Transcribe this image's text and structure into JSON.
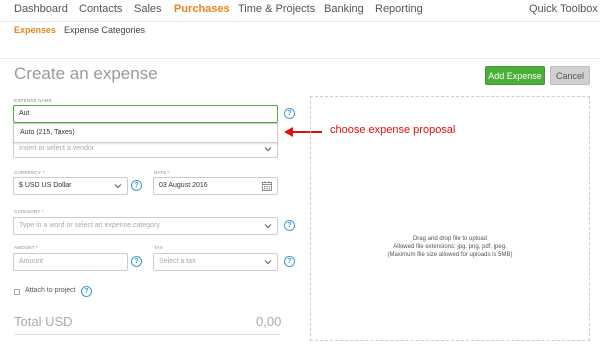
{
  "topnav": {
    "items": [
      "Dashboard",
      "Contacts",
      "Sales",
      "Purchases",
      "Time & Projects",
      "Banking",
      "Reporting"
    ],
    "active": "Purchases",
    "right": "Quick Toolbox"
  },
  "subnav": {
    "items": [
      "Expenses",
      "Expense Categories"
    ],
    "active": "Expenses"
  },
  "page": {
    "title": "Create an expense",
    "add_button": "Add Expense",
    "cancel_button": "Cancel"
  },
  "form": {
    "expense_name": {
      "label": "EXPENSE NAME",
      "value": "Aut"
    },
    "suggestion": "Auto (215, Taxes)",
    "vendor": {
      "placeholder": "Insert or select a vendor"
    },
    "currency": {
      "label": "CURRENCY *",
      "value": "$ USD US Dollar"
    },
    "date": {
      "label": "DATE *",
      "value": "03 August 2016"
    },
    "category": {
      "label": "CATEGORY *",
      "placeholder": "Type in a word or select an expense category"
    },
    "amount": {
      "label": "AMOUNT *",
      "placeholder": "Amount"
    },
    "tax": {
      "label": "TAX",
      "placeholder": "Select a tax"
    },
    "attach_label": "Attach to project",
    "total_label": "Total USD",
    "total_value": "0,00"
  },
  "dropzone": {
    "line1": "Drag and drop file to upload",
    "line2": "Allowed file extensions: jpg, png, pdf, jpeg.",
    "line3": "(Maximum file size allowed for uploads is 5MB)"
  },
  "annotation": {
    "text": "choose expense proposal",
    "color": "#e01010"
  },
  "colors": {
    "accent_orange": "#e8841c",
    "primary_green": "#4aae38",
    "help_blue": "#3a9ec9"
  },
  "icons": {
    "help": "?",
    "help_name": "help-icon",
    "chevron_name": "chevron-down-icon",
    "calendar_name": "calendar-icon",
    "arrow_name": "arrow-left-icon"
  }
}
